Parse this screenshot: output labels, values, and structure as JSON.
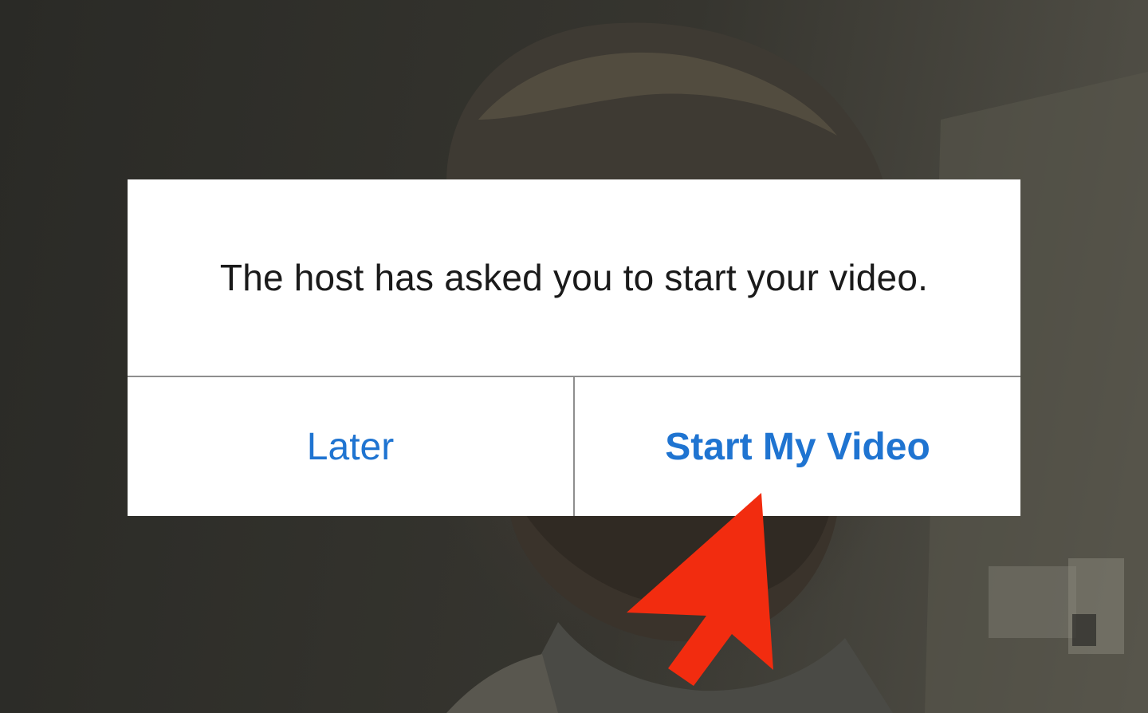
{
  "dialog": {
    "message": "The host has asked you to start your video.",
    "later_label": "Later",
    "start_label": "Start My Video"
  },
  "colors": {
    "button_text": "#1f74d1",
    "annotation_arrow": "#f22c0f"
  },
  "icons": {
    "annotation": "red-arrow-pointer"
  }
}
